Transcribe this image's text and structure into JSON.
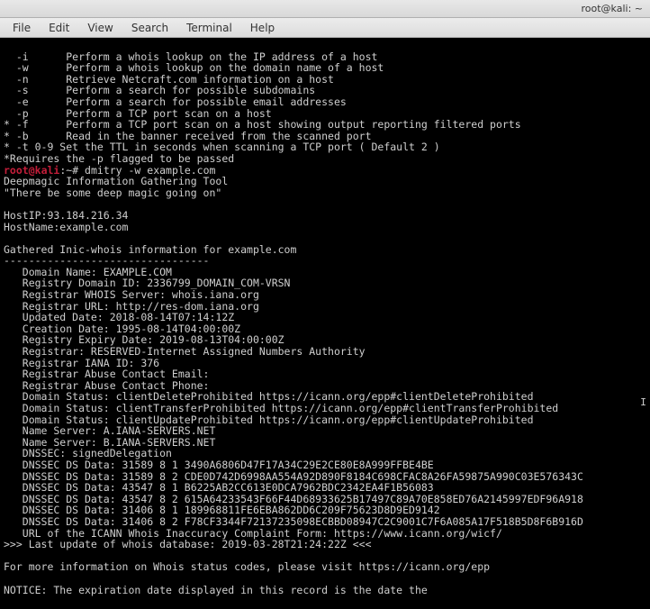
{
  "window": {
    "title": "root@kali: ~"
  },
  "menu": {
    "file": "File",
    "edit": "Edit",
    "view": "View",
    "search": "Search",
    "terminal": "Terminal",
    "help": "Help"
  },
  "term": {
    "help_lines": [
      "  -i      Perform a whois lookup on the IP address of a host",
      "  -w      Perform a whois lookup on the domain name of a host",
      "  -n      Retrieve Netcraft.com information on a host",
      "  -s      Perform a search for possible subdomains",
      "  -e      Perform a search for possible email addresses",
      "  -p      Perform a TCP port scan on a host",
      "* -f      Perform a TCP port scan on a host showing output reporting filtered ports",
      "* -b      Read in the banner received from the scanned port",
      "* -t 0-9 Set the TTL in seconds when scanning a TCP port ( Default 2 )",
      "*Requires the -p flagged to be passed"
    ],
    "prompt": {
      "user": "root",
      "at": "@",
      "host": "kali",
      "path": ":~#",
      "command": " dmitry -w example.com"
    },
    "tool_header": [
      "Deepmagic Information Gathering Tool",
      "\"There be some deep magic going on\"",
      ""
    ],
    "hostinfo": [
      "HostIP:93.184.216.34",
      "HostName:example.com",
      ""
    ],
    "gather_header": "Gathered Inic-whois information for example.com",
    "gather_divider1": "---------------------------------",
    "whois_lines": [
      "   Domain Name: EXAMPLE.COM",
      "   Registry Domain ID: 2336799_DOMAIN_COM-VRSN",
      "   Registrar WHOIS Server: whois.iana.org",
      "   Registrar URL: http://res-dom.iana.org",
      "   Updated Date: 2018-08-14T07:14:12Z",
      "   Creation Date: 1995-08-14T04:00:00Z",
      "   Registry Expiry Date: 2019-08-13T04:00:00Z",
      "   Registrar: RESERVED-Internet Assigned Numbers Authority",
      "   Registrar IANA ID: 376",
      "   Registrar Abuse Contact Email:",
      "   Registrar Abuse Contact Phone:",
      "   Domain Status: clientDeleteProhibited https://icann.org/epp#clientDeleteProhibited",
      "   Domain Status: clientTransferProhibited https://icann.org/epp#clientTransferProhibited",
      "   Domain Status: clientUpdateProhibited https://icann.org/epp#clientUpdateProhibited",
      "   Name Server: A.IANA-SERVERS.NET",
      "   Name Server: B.IANA-SERVERS.NET",
      "   DNSSEC: signedDelegation",
      "   DNSSEC DS Data: 31589 8 1 3490A6806D47F17A34C29E2CE80E8A999FFBE4BE",
      "   DNSSEC DS Data: 31589 8 2 CDE0D742D6998AA554A92D890F8184C698CFAC8A26FA59875A990C03E576343C",
      "   DNSSEC DS Data: 43547 8 1 B6225AB2CC613E0DCA7962BDC2342EA4F1B56083",
      "   DNSSEC DS Data: 43547 8 2 615A64233543F66F44D68933625B17497C89A70E858ED76A2145997EDF96A918",
      "   DNSSEC DS Data: 31406 8 1 189968811FE6EBA862DD6C209F75623D8D9ED9142",
      "   DNSSEC DS Data: 31406 8 2 F78CF3344F72137235098ECBBD08947C2C9001C7F6A085A17F518B5D8F6B916D",
      "   URL of the ICANN Whois Inaccuracy Complaint Form: https://www.icann.org/wicf/",
      ">>> Last update of whois database: 2019-03-28T21:24:22Z <<<"
    ],
    "footer": [
      "",
      "For more information on Whois status codes, please visit https://icann.org/epp",
      "",
      "NOTICE: The expiration date displayed in this record is the date the"
    ],
    "divider2": "---------------------------------"
  }
}
